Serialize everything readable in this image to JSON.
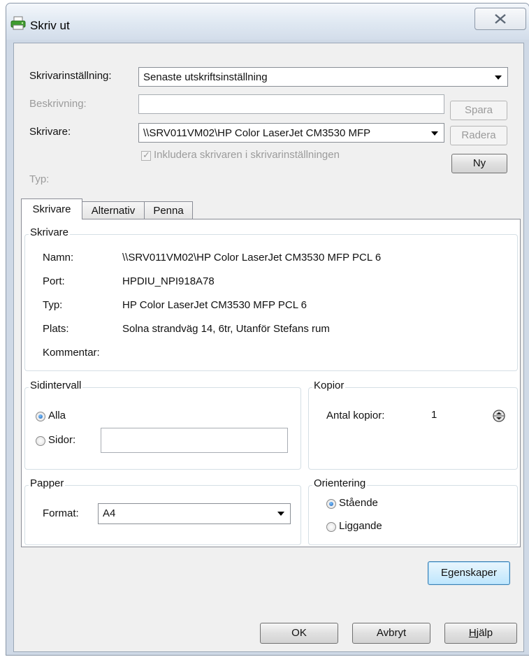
{
  "window": {
    "title": "Skriv ut",
    "close_label": "X"
  },
  "settings": {
    "printer_setting_label": "Skrivarinställning:",
    "printer_setting_value": "Senaste utskriftsinställning",
    "description_label": "Beskrivning:",
    "description_value": "",
    "save_label": "Spara",
    "printer_label": "Skrivare:",
    "printer_value": "\\\\SRV011VM02\\HP Color LaserJet CM3530 MFP",
    "delete_label": "Radera",
    "include_printer_label": "Inkludera skrivaren i skrivarinställningen",
    "include_printer_checked": true,
    "new_label": "Ny",
    "type_label": "Typ:"
  },
  "tabs": [
    {
      "label": "Skrivare",
      "active": true
    },
    {
      "label": "Alternativ",
      "active": false
    },
    {
      "label": "Penna",
      "active": false
    }
  ],
  "printer_group": {
    "title": "Skrivare",
    "rows": [
      {
        "label": "Namn:",
        "value": "\\\\SRV011VM02\\HP Color LaserJet CM3530 MFP PCL 6"
      },
      {
        "label": "Port:",
        "value": "HPDIU_NPI918A78"
      },
      {
        "label": "Typ:",
        "value": "HP Color LaserJet CM3530 MFP PCL 6"
      },
      {
        "label": "Plats:",
        "value": "Solna strandväg 14, 6tr, Utanför Stefans rum"
      },
      {
        "label": "Kommentar:",
        "value": ""
      }
    ]
  },
  "page_range": {
    "title": "Sidintervall",
    "all_label": "Alla",
    "pages_label": "Sidor:",
    "selected": "Alla",
    "pages_value": ""
  },
  "copies": {
    "title": "Kopior",
    "count_label": "Antal kopior:",
    "count_value": "1"
  },
  "paper": {
    "title": "Papper",
    "format_label": "Format:",
    "format_value": "A4"
  },
  "orientation": {
    "title": "Orientering",
    "portrait_label": "Stående",
    "landscape_label": "Liggande",
    "selected": "Stående"
  },
  "buttons": {
    "properties_label": "Egenskaper",
    "ok_label": "OK",
    "cancel_label": "Avbryt",
    "help_label": "Hjälp"
  },
  "colors": {
    "title_gradient_top": "#f4f7fb",
    "dialog_background": "#f0f0f0",
    "focus_border": "#3c7fb1",
    "radio_selected": "#1c5fb4"
  },
  "icons": {
    "title_icon": "printer-icon",
    "close_icon": "close-icon"
  }
}
